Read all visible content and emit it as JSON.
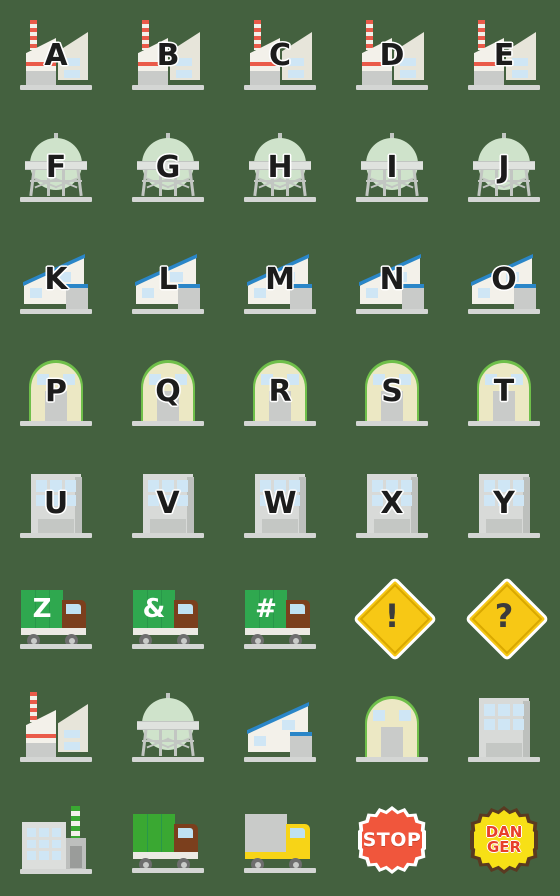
{
  "page": {
    "background_color": "#44613f",
    "title": "Industrial Buildings & Vehicles Emoji Set",
    "grid": {
      "columns": 5,
      "rows": 8,
      "cell_size_px": 112
    }
  },
  "palette": {
    "background": "#44613f",
    "factory_cream": "#f3f1ea",
    "chimney_red": "#ea5b4a",
    "gastank_green": "#cfe3cb",
    "roof_blue": "#2a86c8",
    "arch_green": "#6fbf4a",
    "arch_cream": "#ece8c4",
    "office_grey": "#d8dad8",
    "window_blue": "#cfe6f5",
    "truck_green": "#2fa84f",
    "truck_cab_brown": "#7b3f1d",
    "truck_yellow": "#f7d417",
    "sign_yellow": "#f7c815",
    "stop_red": "#f0563c",
    "danger_yellow": "#f7e016",
    "danger_text_red": "#e8402a",
    "letter_black": "#1c1c1c",
    "letter_outline": "#ffffff"
  },
  "tiles": [
    {
      "row": 1,
      "col": 1,
      "kind": "factory",
      "label": "A",
      "name": "factory-letter-a"
    },
    {
      "row": 1,
      "col": 2,
      "kind": "factory",
      "label": "B",
      "name": "factory-letter-b"
    },
    {
      "row": 1,
      "col": 3,
      "kind": "factory",
      "label": "C",
      "name": "factory-letter-c"
    },
    {
      "row": 1,
      "col": 4,
      "kind": "factory",
      "label": "D",
      "name": "factory-letter-d"
    },
    {
      "row": 1,
      "col": 5,
      "kind": "factory",
      "label": "E",
      "name": "factory-letter-e"
    },
    {
      "row": 2,
      "col": 1,
      "kind": "gastank",
      "label": "F",
      "name": "gas-tank-letter-f"
    },
    {
      "row": 2,
      "col": 2,
      "kind": "gastank",
      "label": "G",
      "name": "gas-tank-letter-g"
    },
    {
      "row": 2,
      "col": 3,
      "kind": "gastank",
      "label": "H",
      "name": "gas-tank-letter-h"
    },
    {
      "row": 2,
      "col": 4,
      "kind": "gastank",
      "label": "I",
      "name": "gas-tank-letter-i"
    },
    {
      "row": 2,
      "col": 5,
      "kind": "gastank",
      "label": "J",
      "name": "gas-tank-letter-j"
    },
    {
      "row": 3,
      "col": 1,
      "kind": "warehouse",
      "label": "K",
      "name": "warehouse-letter-k"
    },
    {
      "row": 3,
      "col": 2,
      "kind": "warehouse",
      "label": "L",
      "name": "warehouse-letter-l"
    },
    {
      "row": 3,
      "col": 3,
      "kind": "warehouse",
      "label": "M",
      "name": "warehouse-letter-m"
    },
    {
      "row": 3,
      "col": 4,
      "kind": "warehouse",
      "label": "N",
      "name": "warehouse-letter-n"
    },
    {
      "row": 3,
      "col": 5,
      "kind": "warehouse",
      "label": "O",
      "name": "warehouse-letter-o"
    },
    {
      "row": 4,
      "col": 1,
      "kind": "archwh",
      "label": "P",
      "name": "arch-warehouse-letter-p"
    },
    {
      "row": 4,
      "col": 2,
      "kind": "archwh",
      "label": "Q",
      "name": "arch-warehouse-letter-q"
    },
    {
      "row": 4,
      "col": 3,
      "kind": "archwh",
      "label": "R",
      "name": "arch-warehouse-letter-r"
    },
    {
      "row": 4,
      "col": 4,
      "kind": "archwh",
      "label": "S",
      "name": "arch-warehouse-letter-s"
    },
    {
      "row": 4,
      "col": 5,
      "kind": "archwh",
      "label": "T",
      "name": "arch-warehouse-letter-t"
    },
    {
      "row": 5,
      "col": 1,
      "kind": "office",
      "label": "U",
      "name": "office-letter-u"
    },
    {
      "row": 5,
      "col": 2,
      "kind": "office",
      "label": "V",
      "name": "office-letter-v"
    },
    {
      "row": 5,
      "col": 3,
      "kind": "office",
      "label": "W",
      "name": "office-letter-w"
    },
    {
      "row": 5,
      "col": 4,
      "kind": "office",
      "label": "X",
      "name": "office-letter-x"
    },
    {
      "row": 5,
      "col": 5,
      "kind": "office",
      "label": "Y",
      "name": "office-letter-y"
    },
    {
      "row": 6,
      "col": 1,
      "kind": "truck",
      "label": "Z",
      "name": "truck-letter-z"
    },
    {
      "row": 6,
      "col": 2,
      "kind": "truck",
      "label": "&",
      "name": "truck-ampersand"
    },
    {
      "row": 6,
      "col": 3,
      "kind": "truck",
      "label": "#",
      "name": "truck-hash"
    },
    {
      "row": 6,
      "col": 4,
      "kind": "warnsign",
      "label": "!",
      "name": "warning-sign-exclamation"
    },
    {
      "row": 6,
      "col": 5,
      "kind": "warnsign",
      "label": "?",
      "name": "warning-sign-question"
    },
    {
      "row": 7,
      "col": 1,
      "kind": "factory",
      "label": "",
      "name": "factory-plain"
    },
    {
      "row": 7,
      "col": 2,
      "kind": "gastank",
      "label": "",
      "name": "gas-tank-plain"
    },
    {
      "row": 7,
      "col": 3,
      "kind": "warehouse",
      "label": "",
      "name": "warehouse-plain"
    },
    {
      "row": 7,
      "col": 4,
      "kind": "archwh",
      "label": "",
      "name": "arch-warehouse-plain"
    },
    {
      "row": 7,
      "col": 5,
      "kind": "office",
      "label": "",
      "name": "office-plain"
    },
    {
      "row": 8,
      "col": 1,
      "kind": "plant",
      "label": "",
      "name": "factory-with-chimney-plain"
    },
    {
      "row": 8,
      "col": 2,
      "kind": "truckgreen",
      "label": "",
      "name": "green-truck-plain"
    },
    {
      "row": 8,
      "col": 3,
      "kind": "truckyellow",
      "label": "",
      "name": "yellow-truck-plain"
    },
    {
      "row": 8,
      "col": 4,
      "kind": "stopbadge",
      "label": "STOP",
      "name": "stop-badge"
    },
    {
      "row": 8,
      "col": 5,
      "kind": "dangerbadge",
      "label": "DANGER",
      "name": "danger-badge",
      "line1": "DAN",
      "line2": "GER"
    }
  ]
}
